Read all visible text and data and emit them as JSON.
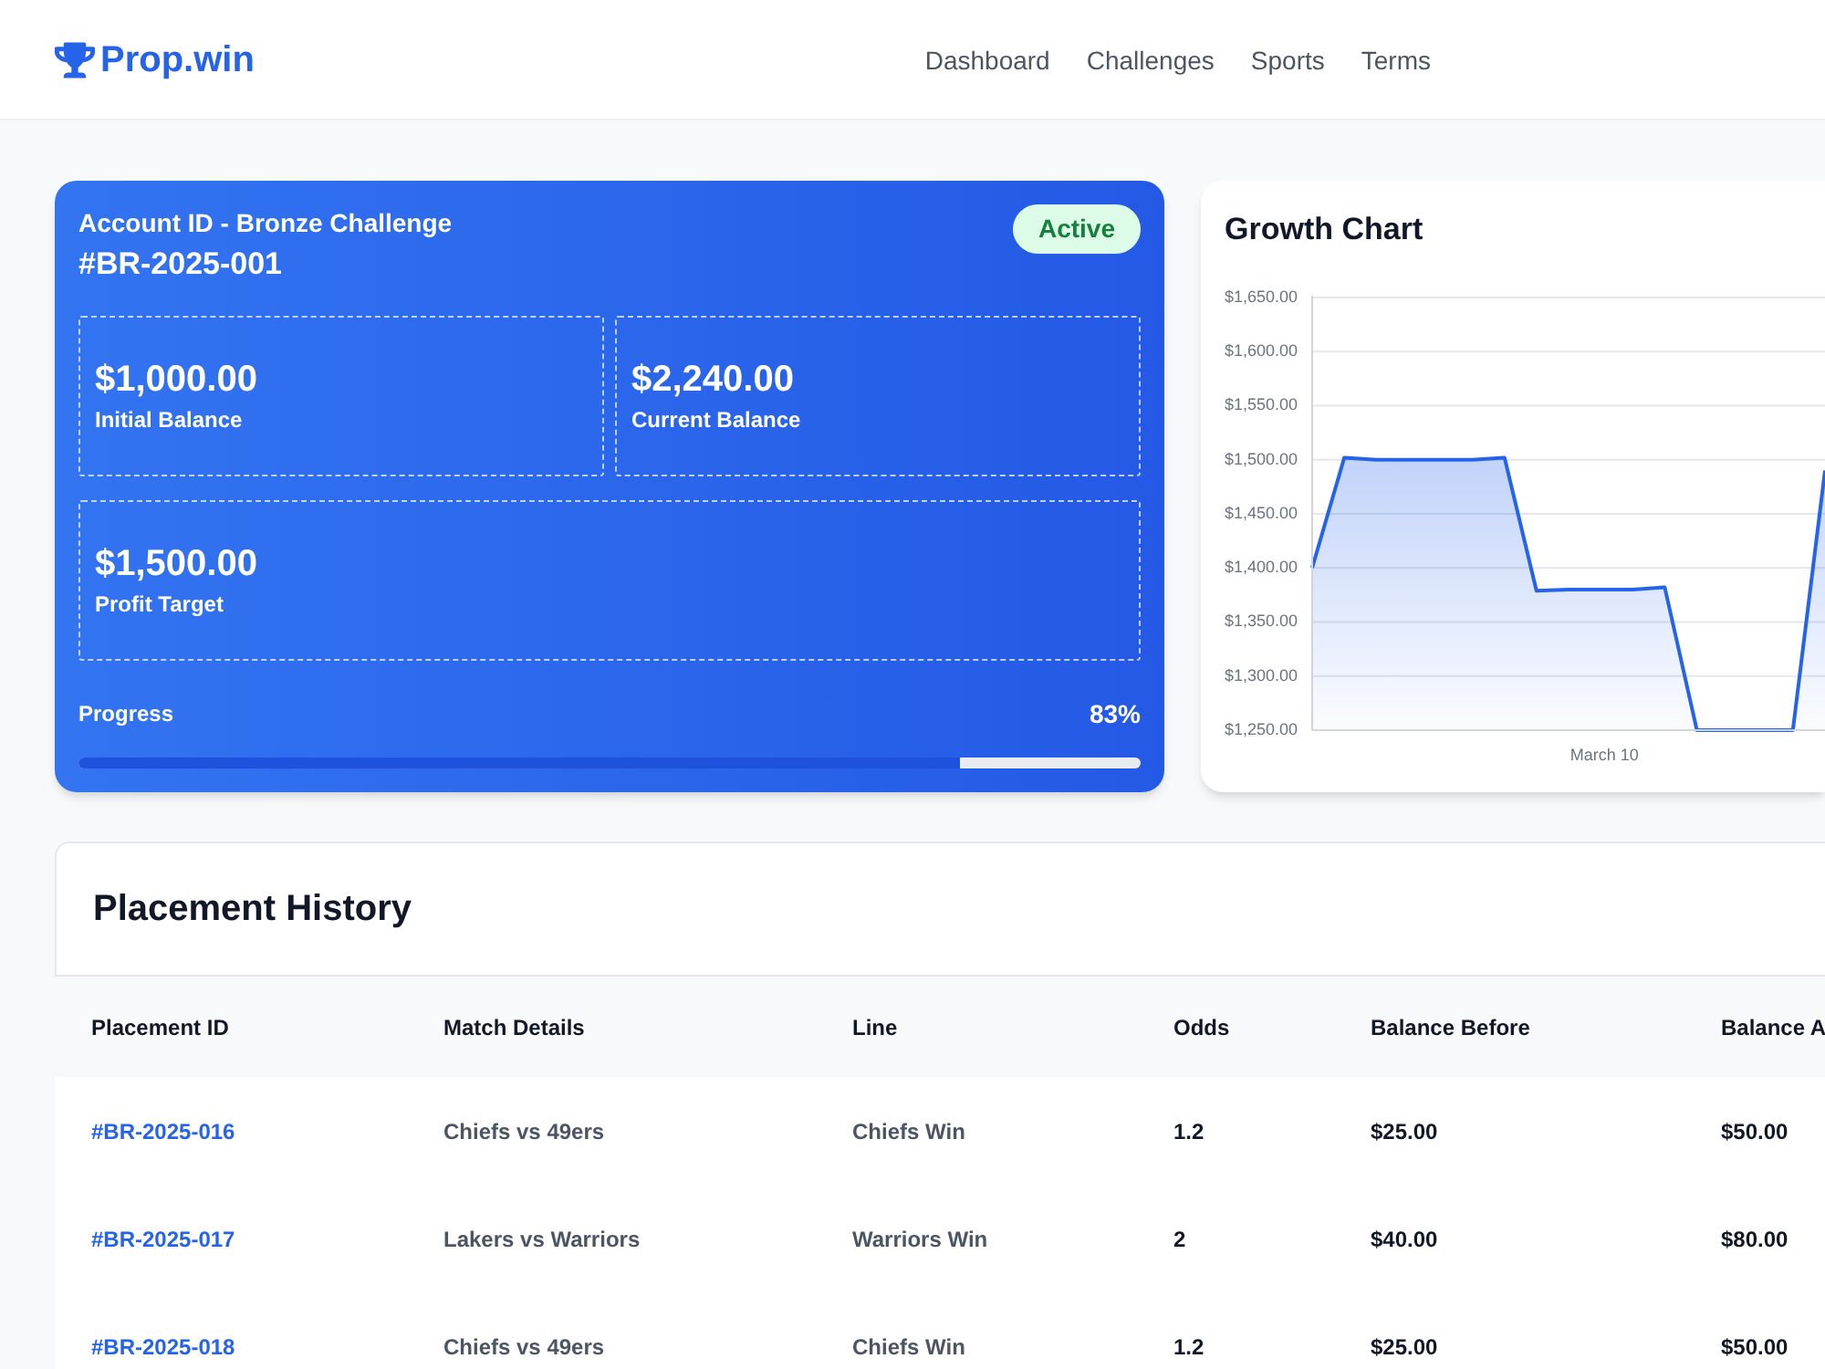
{
  "header": {
    "logo": "Prop.win",
    "nav": [
      "Dashboard",
      "Challenges",
      "Sports",
      "Terms"
    ]
  },
  "account": {
    "title": "Account ID - Bronze Challenge",
    "id": "#BR-2025-001",
    "status": "Active",
    "stats": [
      {
        "value": "$1,000.00",
        "label": "Initial Balance"
      },
      {
        "value": "$2,240.00",
        "label": "Current Balance"
      },
      {
        "value": "$1,500.00",
        "label": "Profit Target"
      }
    ],
    "progress": {
      "label": "Progress",
      "reading": "83%",
      "level": 0.83
    }
  },
  "growth_chart": {
    "title": "Growth Chart",
    "chart_data": {
      "type": "area",
      "xlabel": "March 10",
      "series": [
        {
          "color": "#2563eb",
          "values": [
            1400,
            1502,
            1500,
            1500,
            1500,
            1500,
            1502,
            1379,
            1380,
            1380,
            1380,
            1382,
            1250,
            1250,
            1250,
            1250,
            1490
          ]
        }
      ],
      "ylim": [
        1250,
        1650
      ],
      "yticks": [
        {
          "value": 1250,
          "label": "$1,250.00"
        },
        {
          "value": 1300,
          "label": "$1,300.00"
        },
        {
          "value": 1350,
          "label": "$1,350.00"
        },
        {
          "value": 1400,
          "label": "$1,400.00"
        },
        {
          "value": 1450,
          "label": "$1,450.00"
        },
        {
          "value": 1500,
          "label": "$1,500.00"
        },
        {
          "value": 1550,
          "label": "$1,550.00"
        },
        {
          "value": 1600,
          "label": "$1,600.00"
        },
        {
          "value": 1650,
          "label": "$1,650.00"
        }
      ],
      "grid": true
    }
  },
  "placement_history": {
    "title": "Placement History",
    "columns": [
      "Placement ID",
      "Match Details",
      "Line",
      "Odds",
      "Balance Before",
      "Balance A"
    ],
    "rows": [
      [
        "#BR-2025-016",
        "Chiefs vs 49ers",
        "Chiefs Win",
        "1.2",
        "$25.00",
        "$50.00"
      ],
      [
        "#BR-2025-017",
        "Lakers vs Warriors",
        "Warriors Win",
        "2",
        "$40.00",
        "$80.00"
      ],
      [
        "#BR-2025-018",
        "Chiefs vs 49ers",
        "Chiefs Win",
        "1.2",
        "$25.00",
        "$50.00"
      ]
    ]
  }
}
